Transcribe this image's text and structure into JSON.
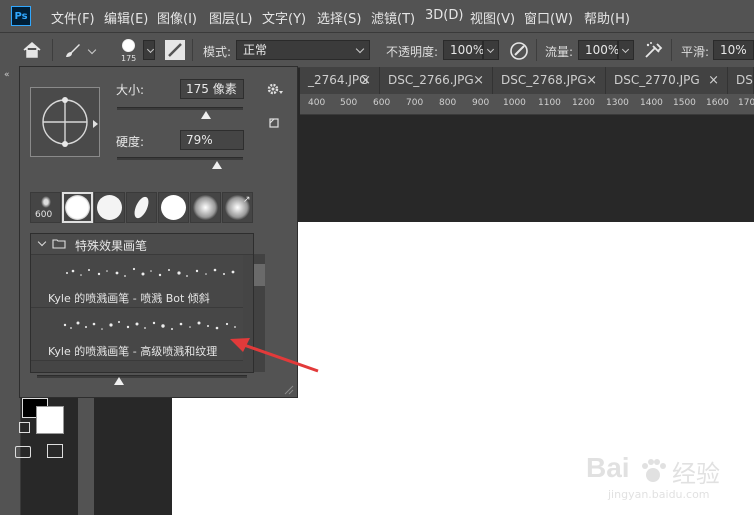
{
  "app": {
    "logo": "Ps"
  },
  "menu": [
    "文件(F)",
    "编辑(E)",
    "图像(I)",
    "图层(L)",
    "文字(Y)",
    "选择(S)",
    "滤镜(T)",
    "3D(D)",
    "视图(V)",
    "窗口(W)",
    "帮助(H)"
  ],
  "options": {
    "brush_size_value": "175",
    "mode_label": "模式:",
    "mode_value": "正常",
    "opacity_label": "不透明度:",
    "opacity_value": "100%",
    "flow_label": "流量:",
    "flow_value": "100%",
    "smoothing_label": "平滑:",
    "smoothing_value": "10%"
  },
  "tabs": [
    "_2764.JPG",
    "DSC_2766.JPG",
    "DSC_2768.JPG",
    "DSC_2770.JPG",
    "DS"
  ],
  "ruler_ticks": [
    "400",
    "500",
    "600",
    "700",
    "800",
    "900",
    "1000",
    "1100",
    "1200",
    "1300",
    "1400",
    "1500",
    "1600",
    "170"
  ],
  "brush_panel": {
    "size_label": "大小:",
    "size_value": "175 像素",
    "size_fraction": 0.71,
    "hardness_label": "硬度:",
    "hardness_value": "79%",
    "hardness_fraction": 0.79,
    "first_preset_number": "600",
    "group_name": "特殊效果画笔",
    "brushes": [
      {
        "name": "Kyle 的喷溅画笔 - 喷溅 Bot 倾斜"
      },
      {
        "name": "Kyle 的喷溅画笔 - 高级喷溅和纹理"
      }
    ],
    "preview_fraction": 0.39
  },
  "watermark": {
    "line1": "Bai",
    "line2": "经验",
    "url": "jingyan.baidu.com"
  },
  "colors": {
    "accent_red": "#e23a3a",
    "ps_blue": "#31a8ff"
  }
}
